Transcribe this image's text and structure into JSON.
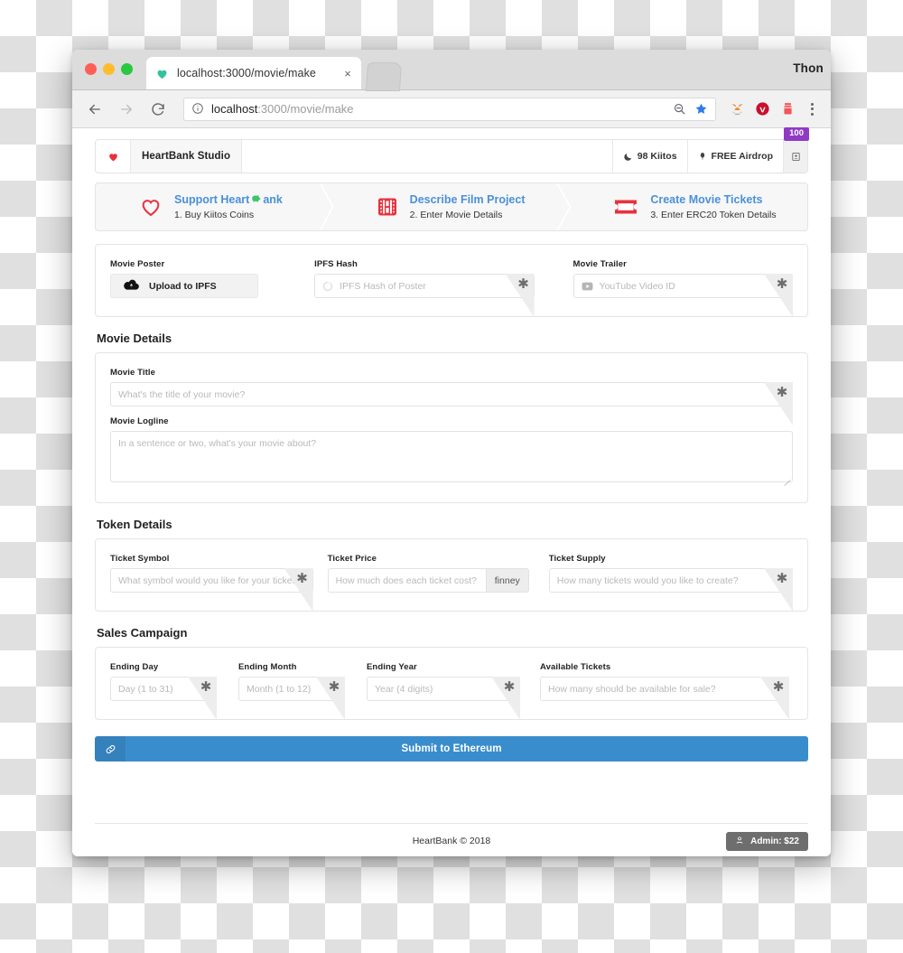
{
  "browser": {
    "tab": {
      "title": "localhost:3000/movie/make",
      "favicon": "heart-icon",
      "close": "×"
    },
    "profile_name": "Thon",
    "omnibox": {
      "url_prefix": "localhost",
      "url_rest": ":3000/movie/make",
      "info_icon": "info-circle-icon"
    },
    "nav": {
      "back": "back-arrow-icon",
      "forward": "forward-arrow-icon",
      "reload": "reload-icon"
    },
    "actions": {
      "zoom_out": "zoom-out-icon",
      "bookmark": "star-icon"
    },
    "extensions": [
      {
        "name": "metamask-extension-icon",
        "color": "#e2761b"
      },
      {
        "name": "checkmark-extension-icon",
        "color": "#c8102e"
      },
      {
        "name": "jar-extension-icon",
        "color": "#f2565a"
      }
    ],
    "menu": "kebab-menu-icon"
  },
  "navbar": {
    "logo": "heart-logo-icon",
    "brand": "HeartBank Studio",
    "kiitos": {
      "icon": "moon-icon",
      "label": "98 Kiitos"
    },
    "airdrop": {
      "icon": "balloon-icon",
      "label": "FREE Airdrop"
    },
    "badge": "100",
    "id_button": "id-card-icon"
  },
  "stepper": [
    {
      "icon": "heart-outline-icon",
      "title_pre": "Support Heart ",
      "title_icon": "piggy-bank-icon",
      "title_post": "ank",
      "sub": "1. Buy Kiitos Coins"
    },
    {
      "icon": "film-strip-icon",
      "title_pre": "Describe Film Project",
      "title_icon": "",
      "title_post": "",
      "sub": "2. Enter Movie Details"
    },
    {
      "icon": "movie-ticket-icon",
      "title_pre": "Create Movie Tickets",
      "title_icon": "",
      "title_post": "",
      "sub": "3. Enter ERC20 Token Details"
    }
  ],
  "media": {
    "poster": {
      "label": "Movie Poster",
      "button": "Upload to IPFS",
      "icon": "cloud-upload-icon"
    },
    "ipfs": {
      "label": "IPFS Hash",
      "placeholder": "IPFS Hash of Poster",
      "icon": "spinner-icon",
      "required": "✱"
    },
    "trailer": {
      "label": "Movie Trailer",
      "placeholder": "YouTube Video ID",
      "icon": "youtube-icon",
      "required": "✱"
    }
  },
  "movie_details": {
    "title": "Movie Details",
    "movie_title": {
      "label": "Movie Title",
      "placeholder": "What's the title of your movie?",
      "required": "✱"
    },
    "logline": {
      "label": "Movie Logline",
      "placeholder": "In a sentence or two, what's your movie about?"
    }
  },
  "token_details": {
    "title": "Token Details",
    "symbol": {
      "label": "Ticket Symbol",
      "placeholder": "What symbol would you like for your tickets?",
      "required": "✱"
    },
    "price": {
      "label": "Ticket Price",
      "placeholder": "How much does each ticket cost?",
      "addon": "finney"
    },
    "supply": {
      "label": "Ticket Supply",
      "placeholder": "How many tickets would you like to create?",
      "required": "✱"
    }
  },
  "sales_campaign": {
    "title": "Sales Campaign",
    "day": {
      "label": "Ending Day",
      "placeholder": "Day (1 to 31)",
      "required": "✱"
    },
    "month": {
      "label": "Ending Month",
      "placeholder": "Month (1 to 12)",
      "required": "✱"
    },
    "year": {
      "label": "Ending Year",
      "placeholder": "Year (4 digits)",
      "required": "✱"
    },
    "available": {
      "label": "Available Tickets",
      "placeholder": "How many should be available for sale?",
      "required": "✱"
    }
  },
  "submit": {
    "label": "Submit to Ethereum",
    "icon": "link-chain-icon",
    "color": "#3a8dcc"
  },
  "footer": {
    "copyright": "HeartBank © 2018",
    "admin": "Admin: $22",
    "admin_icon": "user-icon"
  }
}
